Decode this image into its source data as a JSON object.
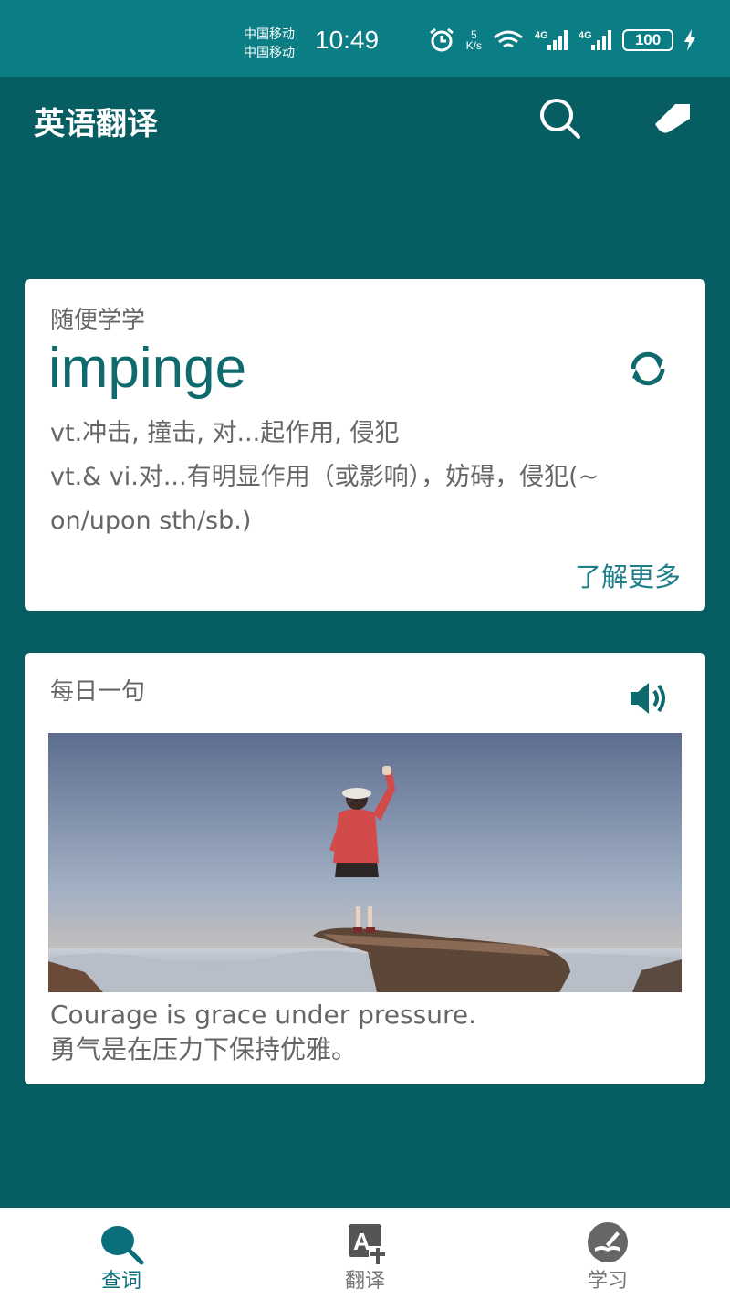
{
  "status_bar": {
    "carrier_1": "中国移动",
    "carrier_2": "中国移动",
    "time": "10:49",
    "net_speed_value": "5",
    "net_speed_unit": "K/s",
    "signal_1": "4G",
    "signal_2": "4G",
    "battery": "100"
  },
  "app_bar": {
    "title": "英语翻译",
    "icons": [
      "search-icon",
      "tag-icon"
    ]
  },
  "word_card": {
    "label": "随便学学",
    "word": "impinge",
    "definitions": [
      "vt.冲击, 撞击, 对...起作用, 侵犯",
      "vt.& vi.对...有明显作用（或影响），妨碍，侵犯(~ on/upon sth/sb.)"
    ],
    "learn_more": "了解更多",
    "icons": [
      "refresh-icon"
    ]
  },
  "daily_card": {
    "label": "每日一句",
    "sentence_en": "Courage is grace under pressure.",
    "sentence_zh": "勇气是在压力下保持优雅。",
    "icons": [
      "speaker-icon"
    ]
  },
  "bottom_nav": {
    "items": [
      {
        "label": "查词",
        "icon": "search-word-icon",
        "active": true
      },
      {
        "label": "翻译",
        "icon": "translate-icon",
        "active": false
      },
      {
        "label": "学习",
        "icon": "study-icon",
        "active": false
      }
    ]
  },
  "colors": {
    "status_bar": "#0a7e84",
    "background": "#075e62",
    "accent": "#0e6a6c",
    "link": "#1e7e8a",
    "nav_active": "#0a6f7c"
  }
}
